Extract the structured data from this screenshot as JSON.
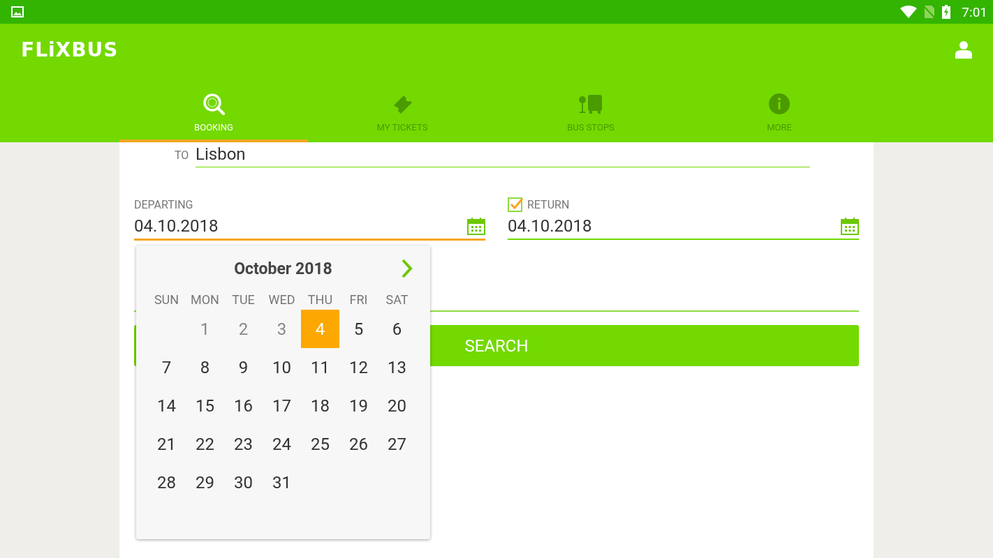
{
  "status_bar": {
    "time": "7:01"
  },
  "app_bar": {
    "logo": "FLiXBUS"
  },
  "tabs": [
    {
      "label": "BOOKING",
      "selected": true
    },
    {
      "label": "MY TICKETS",
      "selected": false
    },
    {
      "label": "BUS STOPS",
      "selected": false
    },
    {
      "label": "MORE",
      "selected": false
    }
  ],
  "form": {
    "to": {
      "label": "TO",
      "value": "Lisbon"
    },
    "departing": {
      "label": "DEPARTING",
      "value": "04.10.2018",
      "focused": true
    },
    "return": {
      "label": "RETURN",
      "value": "04.10.2018",
      "checked": true
    },
    "search_button": "SEARCH"
  },
  "date_picker": {
    "title": "October 2018",
    "weekdays": [
      "SUN",
      "MON",
      "TUE",
      "WED",
      "THU",
      "FRI",
      "SAT"
    ],
    "weeks": [
      [
        {
          "day": "1",
          "disabled": true,
          "selected": false
        },
        {
          "day": "2",
          "disabled": true,
          "selected": false
        },
        {
          "day": "3",
          "disabled": true,
          "selected": false
        },
        {
          "day": "4",
          "disabled": false,
          "selected": true
        },
        {
          "day": "5",
          "disabled": false,
          "selected": false
        },
        {
          "day": "6",
          "disabled": false,
          "selected": false
        }
      ],
      [
        {
          "day": "7",
          "disabled": false,
          "selected": false
        },
        {
          "day": "8",
          "disabled": false,
          "selected": false
        },
        {
          "day": "9",
          "disabled": false,
          "selected": false
        },
        {
          "day": "10",
          "disabled": false,
          "selected": false
        },
        {
          "day": "11",
          "disabled": false,
          "selected": false
        },
        {
          "day": "12",
          "disabled": false,
          "selected": false
        },
        {
          "day": "13",
          "disabled": false,
          "selected": false
        }
      ],
      [
        {
          "day": "14",
          "disabled": false,
          "selected": false
        },
        {
          "day": "15",
          "disabled": false,
          "selected": false
        },
        {
          "day": "16",
          "disabled": false,
          "selected": false
        },
        {
          "day": "17",
          "disabled": false,
          "selected": false
        },
        {
          "day": "18",
          "disabled": false,
          "selected": false
        },
        {
          "day": "19",
          "disabled": false,
          "selected": false
        },
        {
          "day": "20",
          "disabled": false,
          "selected": false
        }
      ],
      [
        {
          "day": "21",
          "disabled": false,
          "selected": false
        },
        {
          "day": "22",
          "disabled": false,
          "selected": false
        },
        {
          "day": "23",
          "disabled": false,
          "selected": false
        },
        {
          "day": "24",
          "disabled": false,
          "selected": false
        },
        {
          "day": "25",
          "disabled": false,
          "selected": false
        },
        {
          "day": "26",
          "disabled": false,
          "selected": false
        },
        {
          "day": "27",
          "disabled": false,
          "selected": false
        }
      ],
      [
        {
          "day": "28",
          "disabled": false,
          "selected": false
        },
        {
          "day": "29",
          "disabled": false,
          "selected": false
        },
        {
          "day": "30",
          "disabled": false,
          "selected": false
        },
        {
          "day": "31",
          "disabled": false,
          "selected": false
        }
      ]
    ]
  }
}
